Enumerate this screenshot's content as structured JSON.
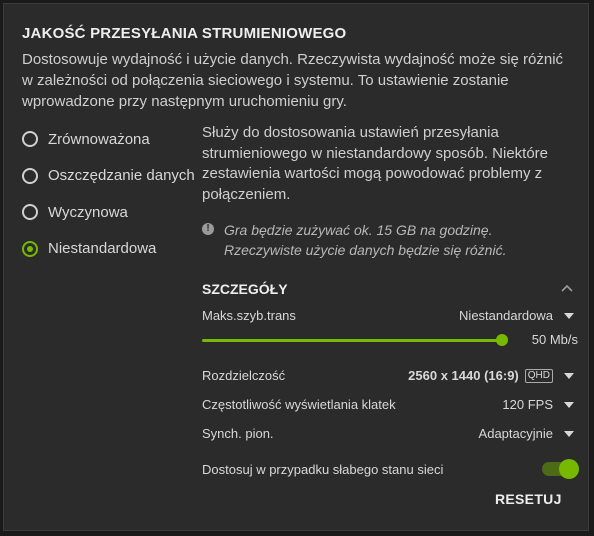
{
  "title": "JAKOŚĆ PRZESYŁANIA STRUMIENIOWEGO",
  "description": "Dostosowuje wydajność i użycie danych. Rzeczywista wydajność może się różnić w zależności od połączenia sieciowego i systemu. To ustawienie zostanie wprowadzone przy następnym uruchomieniu gry.",
  "presets": [
    {
      "label": "Zrównoważona",
      "selected": false
    },
    {
      "label": "Oszczędzanie danych",
      "selected": false
    },
    {
      "label": "Wyczynowa",
      "selected": false
    },
    {
      "label": "Niestandardowa",
      "selected": true
    }
  ],
  "custom_description": "Służy do dostosowania ustawień przesyłania strumieniowego w niestandardowy sposób. Niektóre zestawienia wartości mogą powodować problemy z połączeniem.",
  "note": "Gra będzie zużywać ok. 15 GB na godzinę. Rzeczywiste użycie danych będzie się różnić.",
  "details": {
    "title": "SZCZEGÓŁY",
    "max_bitrate": {
      "label": "Maks.szyb.trans",
      "value": "Niestandardowa",
      "slider_value": "50 Mb/s",
      "slider_fraction": 1.0
    },
    "resolution": {
      "label": "Rozdzielczość",
      "value": "2560 x 1440 (16:9)",
      "badge": "QHD"
    },
    "framerate": {
      "label": "Częstotliwość wyświetlania klatek",
      "value": "120 FPS"
    },
    "vsync": {
      "label": "Synch. pion.",
      "value": "Adaptacyjnie"
    },
    "adjust_poor_network": {
      "label": "Dostosuj w przypadku słabego stanu sieci",
      "enabled": true
    }
  },
  "reset_label": "RESETUJ",
  "colors": {
    "accent": "#76b900",
    "background": "#2b2b2b"
  }
}
